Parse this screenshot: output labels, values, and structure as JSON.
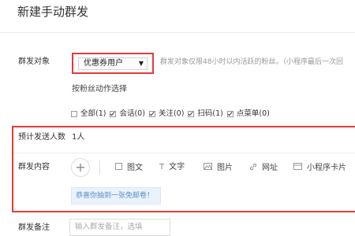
{
  "page": {
    "title": "新建手动群发"
  },
  "target": {
    "label": "群发对象",
    "selected": "优惠券用户",
    "caret": "▼",
    "hint": "群发对象仅限48小时以内活跃的粉丝。（小程序最后一次回",
    "action_label": "按粉丝动作选择"
  },
  "filters": [
    {
      "label": "全部(1)",
      "checked": false
    },
    {
      "label": "会话(0)",
      "checked": true
    },
    {
      "label": "关注(0)",
      "checked": true
    },
    {
      "label": "扫码(1)",
      "checked": true
    },
    {
      "label": "点菜单(0)",
      "checked": true
    }
  ],
  "estimate": {
    "label": "预计发送人数",
    "value": "1人"
  },
  "content": {
    "label": "群发内容",
    "add_icon": "plus-icon",
    "tools": [
      {
        "label": "图文",
        "icon": "news-icon"
      },
      {
        "label": "文字",
        "icon": "text-icon"
      },
      {
        "label": "图片",
        "icon": "image-icon"
      },
      {
        "label": "网址",
        "icon": "link-icon"
      },
      {
        "label": "小程序卡片",
        "icon": "miniprogram-icon"
      }
    ],
    "preview_text": "恭喜你抽到一张免邮卷！"
  },
  "remark": {
    "label": "群发备注",
    "placeholder": "输入群发备注，选填"
  },
  "colors": {
    "highlight_border": "#e23b3b",
    "link_blue": "#5a8fc7",
    "preview_bg": "#eaf2fb"
  }
}
